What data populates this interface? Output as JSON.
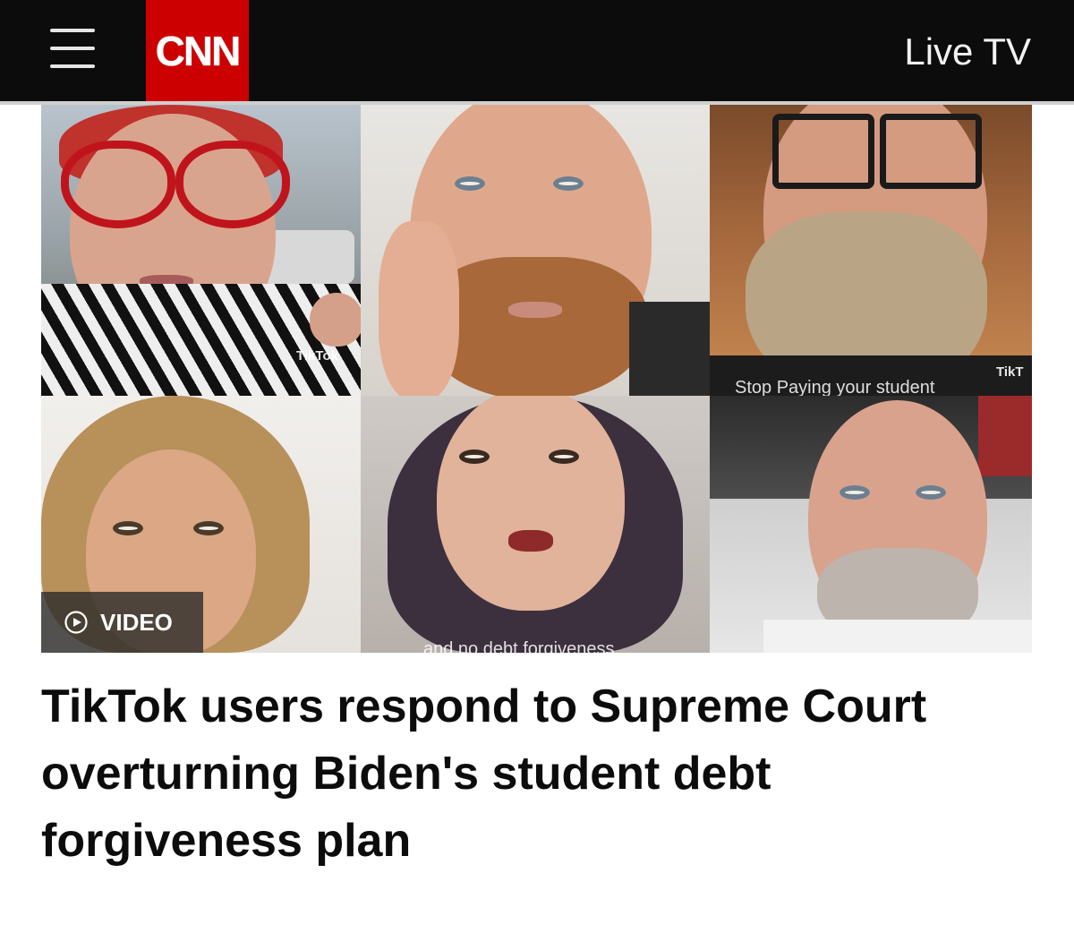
{
  "header": {
    "menu_icon": "hamburger-menu-icon",
    "logo_text": "CNN",
    "live_tv_label": "Live TV"
  },
  "colors": {
    "header_bg": "#0c0c0c",
    "brand_red": "#cc0000",
    "headline_text": "#0c0c0c"
  },
  "media": {
    "badge_icon": "play-circle-icon",
    "badge_label": "VIDEO",
    "tiles": [
      {
        "watermark": "TikTok"
      },
      {
        "watermark": ""
      },
      {
        "watermark": "TikT",
        "caption": "Stop Paying your student"
      },
      {
        "watermark": ""
      },
      {
        "watermark": "",
        "caption": "and no debt forgiveness"
      },
      {
        "watermark": ""
      }
    ]
  },
  "article": {
    "headline": "TikTok users respond to Supreme Court overturning Biden's student debt forgiveness plan"
  }
}
